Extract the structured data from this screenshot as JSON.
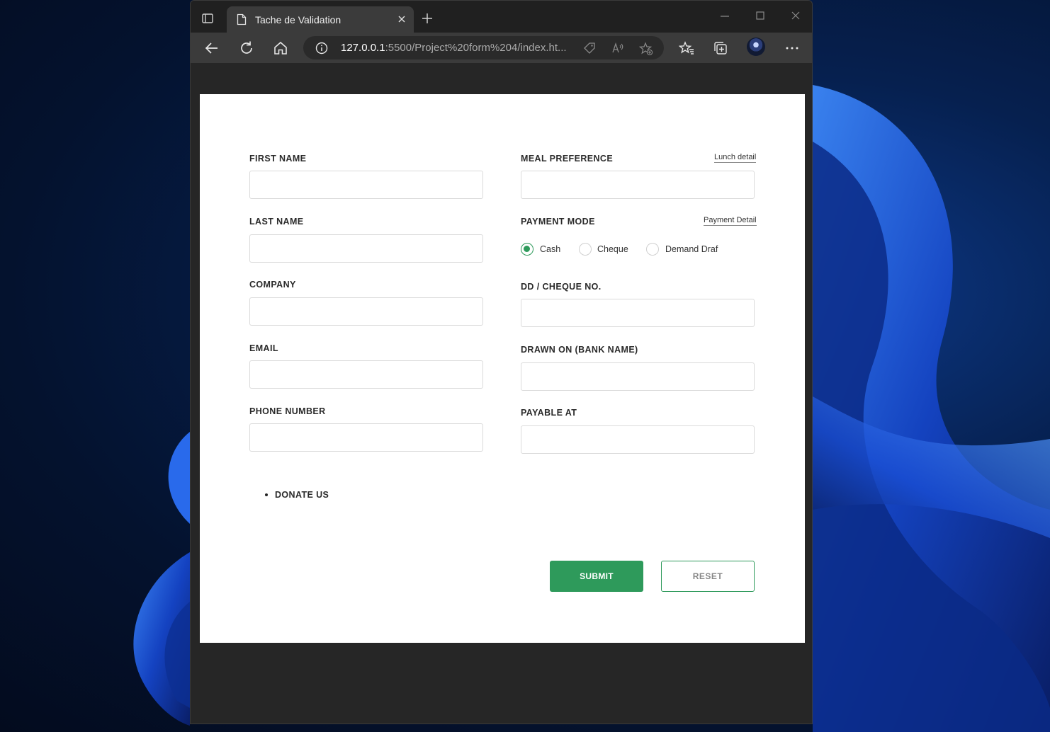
{
  "browser": {
    "tab_title": "Tache de Validation",
    "url_host": "127.0.0.1",
    "url_rest": ":5500/Project%20form%204/index.ht..."
  },
  "form": {
    "left_fields": [
      {
        "label": "FIRST NAME"
      },
      {
        "label": "LAST NAME"
      },
      {
        "label": "COMPANY"
      },
      {
        "label": "EMAIL"
      },
      {
        "label": "PHONE NUMBER"
      }
    ],
    "meal_label": "MEAL PREFERENCE",
    "lunch_link": "Lunch detail",
    "payment_label": "PAYMENT MODE",
    "payment_link": "Payment Detail",
    "payment_options": [
      "Cash",
      "Cheque",
      "Demand Draf"
    ],
    "payment_selected": "Cash",
    "cheque_label": "DD / CHEQUE NO.",
    "bank_label": "DRAWN ON (BANK NAME)",
    "payable_label": "PAYABLE AT",
    "donate": "DONATE US",
    "submit": "SUBMIT",
    "reset": "RESET"
  },
  "colors": {
    "accent": "#2e9a5b",
    "chrome_dark": "#202020",
    "toolbar": "#3b3b3b",
    "viewport": "#262626"
  }
}
